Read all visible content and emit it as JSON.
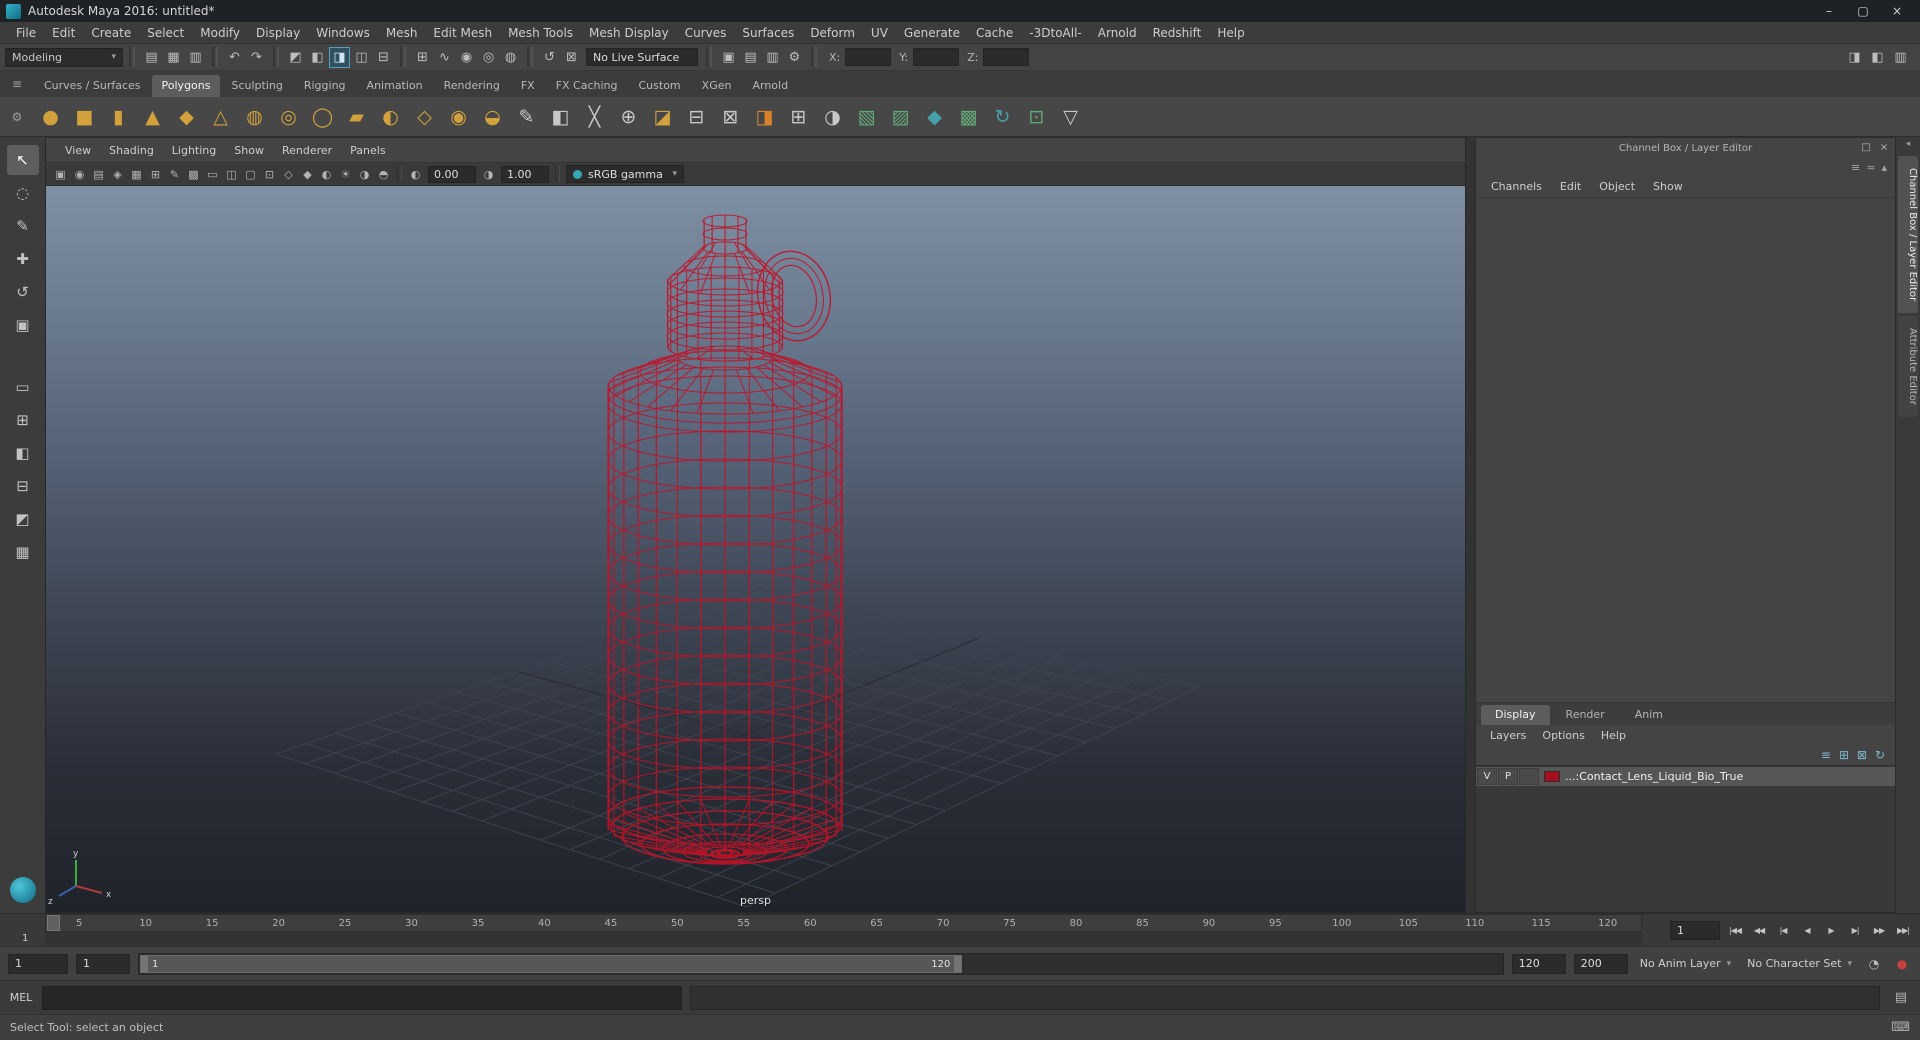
{
  "title_bar": {
    "title": "Autodesk Maya 2016: untitled*",
    "minimize": "–",
    "maximize": "▢",
    "close": "×"
  },
  "glyphs": {
    "chevron_down": "▾",
    "collapse": "◂"
  },
  "menu_bar": {
    "items": [
      "File",
      "Edit",
      "Create",
      "Select",
      "Modify",
      "Display",
      "Windows",
      "Mesh",
      "Edit Mesh",
      "Mesh Tools",
      "Mesh Display",
      "Curves",
      "Surfaces",
      "Deform",
      "UV",
      "Generate",
      "Cache",
      "-3DtoAll-",
      "Arnold",
      "Redshift",
      "Help"
    ]
  },
  "status_line": {
    "menu_set": "Modeling",
    "file_icons": [
      {
        "name": "new-scene-icon",
        "glyph": "▤"
      },
      {
        "name": "open-scene-icon",
        "glyph": "▦"
      },
      {
        "name": "save-scene-icon",
        "glyph": "▥"
      }
    ],
    "undo_icons": [
      {
        "name": "undo-icon",
        "glyph": "↶"
      },
      {
        "name": "redo-icon",
        "glyph": "↷"
      }
    ],
    "selection_icons": [
      {
        "name": "select-hierarchy-icon",
        "glyph": "◩"
      },
      {
        "name": "select-object-icon",
        "glyph": "◧"
      },
      {
        "name": "select-component-icon",
        "glyph": "◨",
        "active": true
      },
      {
        "name": "select-mask-icon",
        "glyph": "◫"
      },
      {
        "name": "highlight-selection-icon",
        "glyph": "⊟"
      }
    ],
    "snap_icons": [
      {
        "name": "snap-grid-icon",
        "glyph": "⊞"
      },
      {
        "name": "snap-curve-icon",
        "glyph": "∿"
      },
      {
        "name": "snap-point-icon",
        "glyph": "◉"
      },
      {
        "name": "snap-center-icon",
        "glyph": "◎"
      },
      {
        "name": "make-live-icon",
        "glyph": "◍"
      }
    ],
    "history_icons": [
      {
        "name": "construction-history-icon",
        "glyph": "↺"
      },
      {
        "name": "inputs-icon",
        "glyph": "⊠"
      }
    ],
    "live_surface": "No Live Surface",
    "render_icons": [
      {
        "name": "render-view-icon",
        "glyph": "▣"
      },
      {
        "name": "render-current-frame-icon",
        "glyph": "▤"
      },
      {
        "name": "ipr-render-icon",
        "glyph": "▥"
      },
      {
        "name": "render-settings-icon",
        "glyph": "⚙"
      }
    ],
    "transform_fields": {
      "x_label": "X:",
      "y_label": "Y:",
      "z_label": "Z:"
    },
    "right_icons": [
      {
        "name": "attribute-editor-toggle-icon",
        "glyph": "◨"
      },
      {
        "name": "tool-settings-toggle-icon",
        "glyph": "◧"
      },
      {
        "name": "channel-box-toggle-icon",
        "glyph": "▥"
      }
    ]
  },
  "shelf": {
    "menu_icon": "≡",
    "gear_icon": "⚙",
    "tabs": [
      {
        "label": "Curves / Surfaces"
      },
      {
        "label": "Polygons",
        "active": true
      },
      {
        "label": "Sculpting"
      },
      {
        "label": "Rigging"
      },
      {
        "label": "Animation"
      },
      {
        "label": "Rendering"
      },
      {
        "label": "FX"
      },
      {
        "label": "FX Caching"
      },
      {
        "label": "Custom"
      },
      {
        "label": "XGen"
      },
      {
        "label": "Arnold"
      }
    ],
    "icons": [
      {
        "name": "poly-sphere-icon",
        "glyph": "●",
        "color": "#d2a13c"
      },
      {
        "name": "poly-cube-icon",
        "glyph": "■",
        "color": "#d2a13c"
      },
      {
        "name": "poly-cylinder-icon",
        "glyph": "▮",
        "color": "#d2a13c"
      },
      {
        "name": "poly-cone-icon",
        "glyph": "▲",
        "color": "#d2a13c"
      },
      {
        "name": "poly-prism-icon",
        "glyph": "◆",
        "color": "#d2a13c"
      },
      {
        "name": "poly-pyramid-icon",
        "glyph": "△",
        "color": "#d2a13c"
      },
      {
        "name": "poly-pipe-icon",
        "glyph": "◍",
        "color": "#d2a13c"
      },
      {
        "name": "poly-helix-icon",
        "glyph": "◎",
        "color": "#d2a13c"
      },
      {
        "name": "poly-torus-icon",
        "glyph": "◯",
        "color": "#d2a13c"
      },
      {
        "name": "poly-plane-icon",
        "glyph": "▰",
        "color": "#d2a13c"
      },
      {
        "name": "poly-disc-icon",
        "glyph": "◐",
        "color": "#d2a13c"
      },
      {
        "name": "poly-platonic-icon",
        "glyph": "◇",
        "color": "#d2a13c"
      },
      {
        "name": "poly-soccer-ball-icon",
        "glyph": "◉",
        "color": "#d2a13c"
      },
      {
        "name": "poly-superellipse-icon",
        "glyph": "◒",
        "color": "#d2a13c"
      },
      {
        "name": "create-polygon-tool-icon",
        "glyph": "✎",
        "color": "#c8c8c8"
      },
      {
        "name": "extrude-icon",
        "glyph": "◧",
        "color": "#c8c8c8"
      },
      {
        "name": "multi-cut-icon",
        "glyph": "╳",
        "color": "#c8c8c8"
      },
      {
        "name": "target-weld-icon",
        "glyph": "⊕",
        "color": "#c8c8c8"
      },
      {
        "name": "bevel-icon",
        "glyph": "◪",
        "color": "#d2a13c"
      },
      {
        "name": "bridge-icon",
        "glyph": "⊟",
        "color": "#c8c8c8"
      },
      {
        "name": "separate-icon",
        "glyph": "⊠",
        "color": "#c8c8c8"
      },
      {
        "name": "mirror-icon",
        "glyph": "◨",
        "color": "#d9822b"
      },
      {
        "name": "boolean-union-icon",
        "glyph": "⊞",
        "color": "#c8c8c8"
      },
      {
        "name": "smooth-icon",
        "glyph": "◑",
        "color": "#c8c8c8"
      },
      {
        "name": "symmetrize-icon",
        "glyph": "▧",
        "color": "#63a877"
      },
      {
        "name": "average-vertices-icon",
        "glyph": "▨",
        "color": "#63a877"
      },
      {
        "name": "make-live-surface-icon",
        "glyph": "◆",
        "color": "#46a0a8"
      },
      {
        "name": "quad-draw-icon",
        "glyph": "▩",
        "color": "#63a877"
      },
      {
        "name": "relax-icon",
        "glyph": "↻",
        "color": "#46a0a8"
      },
      {
        "name": "transfer-attributes-icon",
        "glyph": "⊡",
        "color": "#63a877"
      },
      {
        "name": "reduce-icon",
        "glyph": "▽",
        "color": "#c8c8c8"
      }
    ]
  },
  "toolbox": {
    "tools": [
      {
        "name": "select-tool-icon",
        "glyph": "↖",
        "active": true
      },
      {
        "name": "lasso-tool-icon",
        "glyph": "◌"
      },
      {
        "name": "paint-select-tool-icon",
        "glyph": "✎"
      },
      {
        "name": "move-tool-icon",
        "glyph": "✚"
      },
      {
        "name": "rotate-tool-icon",
        "glyph": "↺"
      },
      {
        "name": "scale-tool-icon",
        "glyph": "▣"
      }
    ],
    "layouts": [
      {
        "name": "layout-single-pane-icon",
        "glyph": "▭"
      },
      {
        "name": "layout-four-pane-icon",
        "glyph": "⊞"
      },
      {
        "name": "layout-persp-outliner-icon",
        "glyph": "◧"
      },
      {
        "name": "layout-persp-graph-icon",
        "glyph": "⊟"
      },
      {
        "name": "layout-hypershade-icon",
        "glyph": "◩"
      },
      {
        "name": "layout-custom-icon",
        "glyph": "▦"
      }
    ]
  },
  "viewport": {
    "menus": [
      "View",
      "Shading",
      "Lighting",
      "Show",
      "Renderer",
      "Panels"
    ],
    "toolbar_icons": [
      {
        "name": "select-camera-icon",
        "glyph": "▣"
      },
      {
        "name": "lock-camera-icon",
        "glyph": "◉"
      },
      {
        "name": "camera-attributes-icon",
        "glyph": "▤"
      },
      {
        "name": "bookmarks-icon",
        "glyph": "◈"
      },
      {
        "name": "image-plane-icon",
        "glyph": "▦"
      },
      {
        "name": "2d-pan-zoom-icon",
        "glyph": "⊞"
      },
      {
        "name": "grease-pencil-icon",
        "glyph": "✎"
      },
      {
        "name": "grid-toggle-icon",
        "glyph": "▩"
      },
      {
        "name": "film-gate-icon",
        "glyph": "▭"
      },
      {
        "name": "resolution-gate-icon",
        "glyph": "◫"
      },
      {
        "name": "gate-mask-icon",
        "glyph": "▢"
      },
      {
        "name": "safe-action-icon",
        "glyph": "⊡"
      },
      {
        "name": "wireframe-mode-icon",
        "glyph": "◇"
      },
      {
        "name": "shaded-mode-icon",
        "glyph": "◆"
      },
      {
        "name": "textured-m ode-icon",
        "glyph": "◐"
      },
      {
        "name": "lights-icon",
        "glyph": "☀"
      },
      {
        "name": "shadows-icon",
        "glyph": "◑"
      },
      {
        "name": "xray-mode-icon",
        "glyph": "◓"
      }
    ],
    "exposure": "0.00",
    "gamma": "1.00",
    "colorspace": "sRGB gamma",
    "camera_label": "persp",
    "axis": {
      "x": "x",
      "y": "y",
      "z": "z"
    }
  },
  "channel_box": {
    "header": "Channel Box / Layer Editor",
    "header_icons": [
      {
        "name": "float-panel-icon",
        "glyph": "□"
      },
      {
        "name": "close-panel-icon",
        "glyph": "×"
      }
    ],
    "mode_icons": [
      {
        "name": "channel-slider-mode-icon",
        "glyph": "≡"
      },
      {
        "name": "channel-speed-mode-icon",
        "glyph": "≈"
      },
      {
        "name": "channel-stats-icon",
        "glyph": "▴"
      }
    ],
    "menus": [
      "Channels",
      "Edit",
      "Object",
      "Show"
    ],
    "layer_editor": {
      "tabs": [
        {
          "label": "Display",
          "active": true
        },
        {
          "label": "Render"
        },
        {
          "label": "Anim"
        }
      ],
      "menus": [
        "Layers",
        "Options",
        "Help"
      ],
      "icons": [
        {
          "name": "sort-layers-icon",
          "glyph": "≡"
        },
        {
          "name": "new-empty-layer-icon",
          "glyph": "⊞"
        },
        {
          "name": "new-layer-from-selected-icon",
          "glyph": "⊠"
        },
        {
          "name": "sync-layers-icon",
          "glyph": "↻"
        }
      ],
      "layer": {
        "visible": "V",
        "playback": "P",
        "color": "#a50f1e",
        "name": "...:Contact_Lens_Liquid_Bio_True"
      }
    }
  },
  "side_tabs": [
    {
      "label": "Channel Box / Layer Editor",
      "active": true
    },
    {
      "label": "Attribute Editor"
    }
  ],
  "time_slider": {
    "ticks": [
      "5",
      "10",
      "15",
      "20",
      "25",
      "30",
      "35",
      "40",
      "45",
      "50",
      "55",
      "60",
      "65",
      "70",
      "75",
      "80",
      "85",
      "90",
      "95",
      "100",
      "105",
      "110",
      "115",
      "120"
    ],
    "current": "1",
    "frame_field": "1",
    "playback": [
      {
        "name": "go-to-start-button",
        "glyph": "|◀◀"
      },
      {
        "name": "step-back-frame-button",
        "glyph": "◀◀"
      },
      {
        "name": "step-back-key-button",
        "glyph": "|◀"
      },
      {
        "name": "play-backwards-button",
        "glyph": "◀"
      },
      {
        "name": "play-forwards-button",
        "glyph": "▶"
      },
      {
        "name": "step-forward-key-button",
        "glyph": "▶|"
      },
      {
        "name": "step-forward-frame-button",
        "glyph": "▶▶"
      },
      {
        "name": "go-to-end-button",
        "glyph": "▶▶|"
      }
    ]
  },
  "range_slider": {
    "animation_start": "1",
    "playback_start": "1",
    "inner_min": "1",
    "inner_max": "120",
    "playback_end": "120",
    "animation_end": "200",
    "anim_layer": "No Anim Layer",
    "character_set": "No Character Set"
  },
  "command_line": {
    "label": "MEL"
  },
  "help_line": {
    "text": "Select Tool: select an object"
  },
  "colors": {
    "wireframe": "#c01328",
    "layer_swatch": "#a50f1e",
    "accent": "#35a7b4",
    "grid": "#3e4450"
  }
}
